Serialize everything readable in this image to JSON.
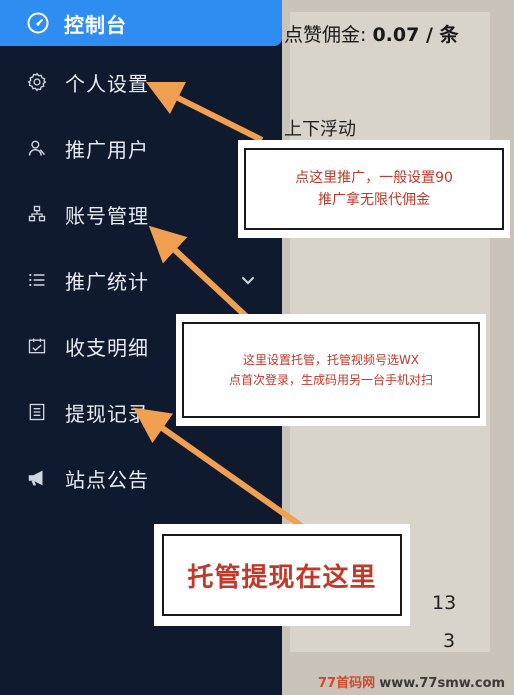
{
  "background_page": {
    "commission_label": "点赞佣金:",
    "commission_value": "0.07 / 条",
    "float_text": "上下浮动",
    "number_1": "13",
    "number_2": "3"
  },
  "sidebar": {
    "active": {
      "label": "控制台",
      "icon": "dashboard-gauge-icon"
    },
    "items": [
      {
        "label": "个人设置",
        "icon": "gear-icon"
      },
      {
        "label": "推广用户",
        "icon": "users-icon"
      },
      {
        "label": "账号管理",
        "icon": "sitemap-icon"
      },
      {
        "label": "推广统计",
        "icon": "list-icon",
        "has_chevron": true
      },
      {
        "label": "收支明细",
        "icon": "calendar-icon"
      },
      {
        "label": "提现记录",
        "icon": "document-list-icon"
      },
      {
        "label": "站点公告",
        "icon": "megaphone-icon"
      }
    ]
  },
  "annotations": {
    "callout_1_line1": "点这里推广，一般设置90",
    "callout_1_line2": "推广拿无限代佣金",
    "callout_2_line1": "这里设置托管，托管视频号选WX",
    "callout_2_line2": "点首次登录，生成码用另一台手机对扫",
    "callout_3": "托管提现在这里",
    "arrow_color": "#f0a050",
    "text_color": "#c0392b"
  },
  "watermark": {
    "part1": "77首码网",
    "part2": "www.77smw.com"
  },
  "colors": {
    "sidebar_bg": "#0f1a2e",
    "active_bg": "#2f8cf0"
  }
}
